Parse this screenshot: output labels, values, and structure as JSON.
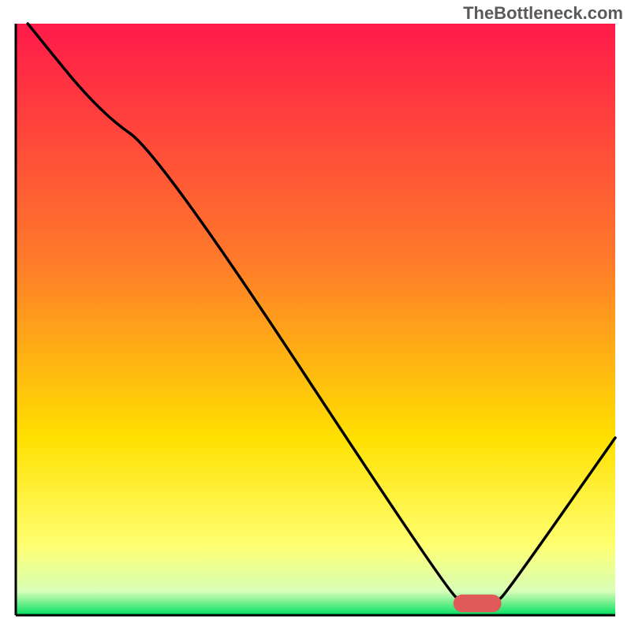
{
  "attribution": "TheBottleneck.com",
  "chart_data": {
    "type": "line",
    "title": "",
    "xlabel": "",
    "ylabel": "",
    "xlim": [
      0,
      100
    ],
    "ylim": [
      0,
      100
    ],
    "gradient_stops": [
      {
        "offset": 0,
        "color": "#ff1a4a"
      },
      {
        "offset": 40,
        "color": "#ff7a2a"
      },
      {
        "offset": 70,
        "color": "#ffe000"
      },
      {
        "offset": 88,
        "color": "#ffff70"
      },
      {
        "offset": 96,
        "color": "#d8ffb8"
      },
      {
        "offset": 100,
        "color": "#00e060"
      }
    ],
    "series": [
      {
        "name": "curve",
        "points": [
          {
            "x": 2,
            "y": 100
          },
          {
            "x": 14,
            "y": 85
          },
          {
            "x": 24,
            "y": 78
          },
          {
            "x": 72,
            "y": 4
          },
          {
            "x": 75,
            "y": 2
          },
          {
            "x": 80,
            "y": 2
          },
          {
            "x": 82,
            "y": 4
          },
          {
            "x": 100,
            "y": 30
          }
        ]
      }
    ],
    "marker": {
      "x": 77,
      "y": 2,
      "color": "#e05a5a",
      "width": 8,
      "height": 3
    }
  }
}
